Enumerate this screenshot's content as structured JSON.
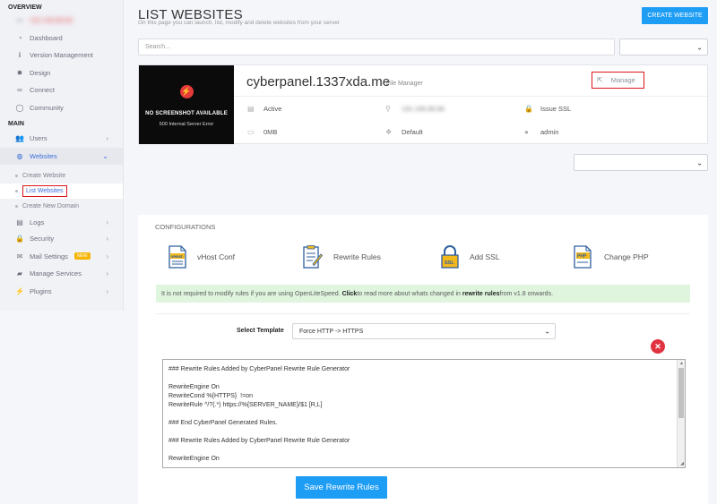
{
  "sidebar": {
    "overview_label": "OVERVIEW",
    "main_label": "MAIN",
    "server_ip": "192.168.88.88",
    "items_top": [
      {
        "label": "Dashboard",
        "icon": "dashboard-icon"
      },
      {
        "label": "Version Management",
        "icon": "info-icon"
      },
      {
        "label": "Design",
        "icon": "gear-icon"
      },
      {
        "label": "Connect",
        "icon": "link-icon"
      },
      {
        "label": "Community",
        "icon": "comment-icon"
      }
    ],
    "users": "Users",
    "websites": "Websites",
    "websites_sub": [
      "Create Website",
      "List Websites",
      "Create New Domain"
    ],
    "items_bottom": [
      {
        "label": "Logs",
        "icon": "file-icon"
      },
      {
        "label": "Security",
        "icon": "lock-icon"
      },
      {
        "label": "Mail Settings",
        "icon": "mail-icon",
        "badge": "NEW"
      },
      {
        "label": "Manage Services",
        "icon": "folder-icon"
      },
      {
        "label": "Plugins",
        "icon": "plug-icon"
      }
    ]
  },
  "header": {
    "title": "LIST WEBSITES",
    "subtitle": "On this page you can launch, list, modify and delete websites from your server",
    "create_button": "CREATE WEBSITE"
  },
  "search": {
    "placeholder": "Search..."
  },
  "website": {
    "domain": "cyberpanel.1337xda.me",
    "file_manager": "– File Manager",
    "manage": "Manage",
    "screenshot_title": "NO SCREENSHOT AVAILABLE",
    "screenshot_error": "500 Internal Server Error",
    "status": "Active",
    "ip": "192.168.88.88",
    "ssl": "Issue SSL",
    "disk": "0MB",
    "package": "Default",
    "owner": "admin"
  },
  "config": {
    "title": "CONFIGURATIONS",
    "items": [
      "vHost Conf",
      "Rewrite Rules",
      "Add SSL",
      "Change PHP"
    ],
    "notice": {
      "part1": "It is not required to modify rules if you are using OpenLiteSpeed. ",
      "click": "Click",
      "part2": " to read more about whats changed in ",
      "rules": "rewrite rules",
      "part3": " from v1.8 onwards."
    },
    "template_label": "Select Template",
    "template_value": "Force HTTP -> HTTPS",
    "editor_lines": [
      "### Rewrite Rules Added by CyberPanel Rewrite Rule Generator",
      "",
      "RewriteEngine On",
      "RewriteCond %{HTTPS}  !=on",
      "RewriteRule ^/?(.*) https://%{SERVER_NAME}/$1 [R,L]",
      "",
      "### End CyberPanel Generated Rules.",
      "",
      "### Rewrite Rules Added by CyberPanel Rewrite Rule Generator",
      "",
      "RewriteEngine On"
    ],
    "save_button": "Save Rewrite Rules"
  },
  "colors": {
    "accent": "#1e9df5",
    "highlight": "#d9151b",
    "notice_bg": "#dff5de",
    "danger": "#e0333f"
  }
}
